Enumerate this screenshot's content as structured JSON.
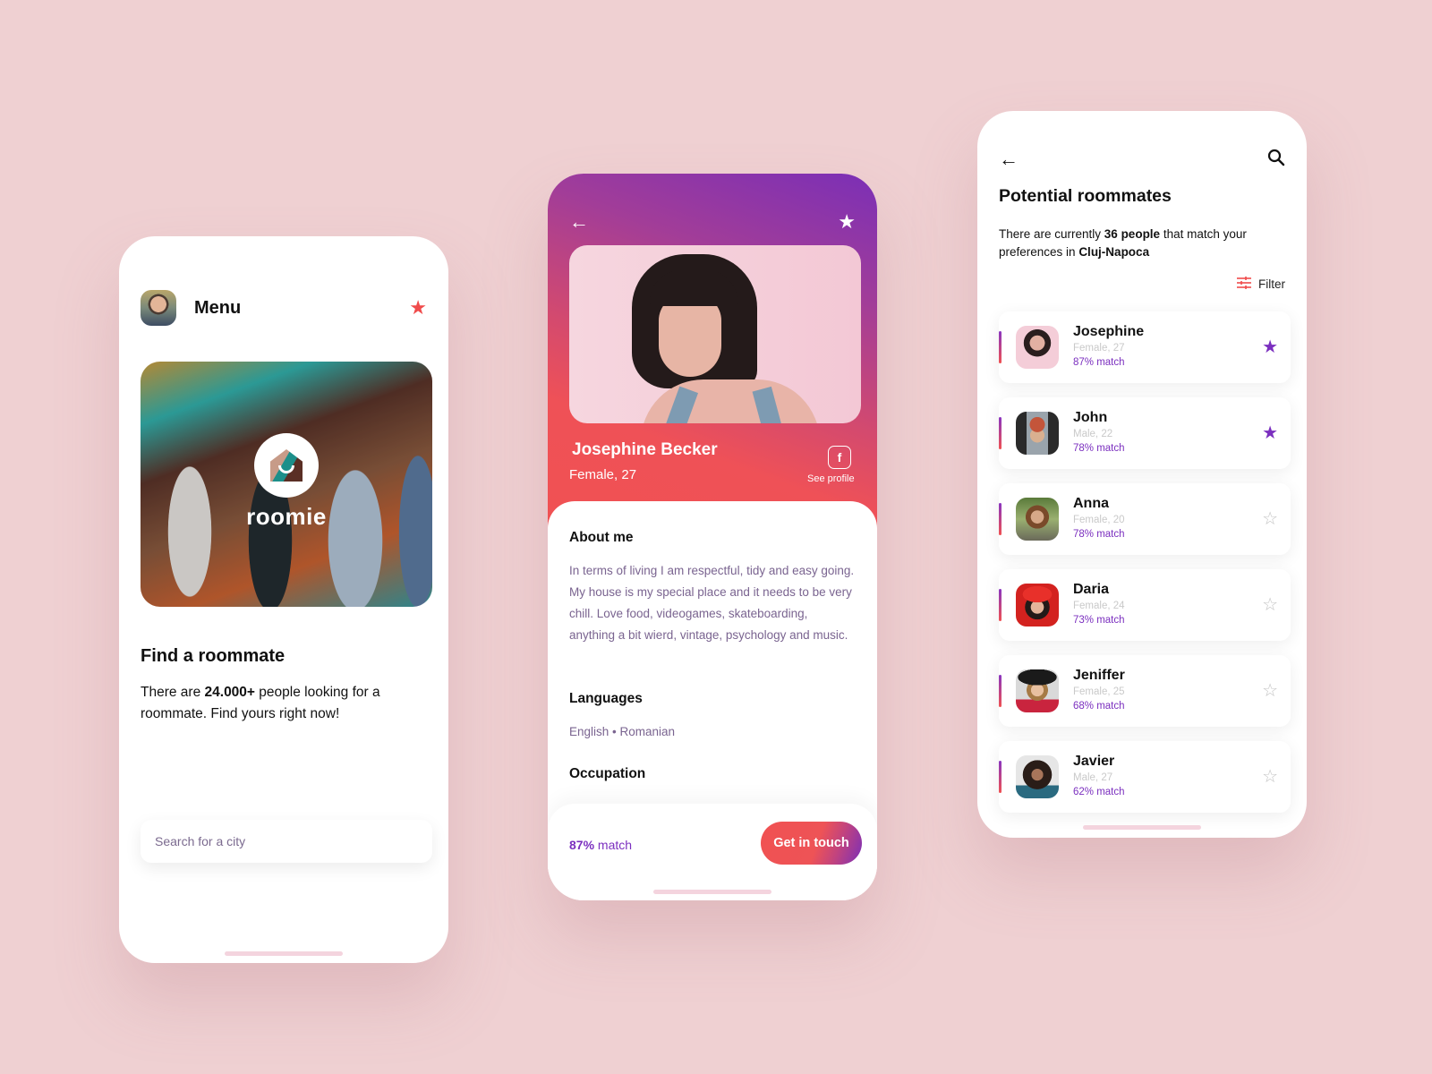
{
  "colors": {
    "background": "#efd0d2",
    "accent_red": "#f04b4b",
    "accent_purple": "#7b2fbf",
    "body_text_purple": "#7a6490"
  },
  "menu_screen": {
    "title": "Menu",
    "star_icon": "star-filled",
    "avatar_icon": "user-avatar",
    "hero_logo_text": "roomie",
    "heading": "Find a roommate",
    "desc_prefix": "There are ",
    "desc_bold": "24.000+",
    "desc_suffix": " people looking for a roommate. Find yours right now!",
    "search": {
      "placeholder": "Search for a city",
      "value": ""
    }
  },
  "profile_screen": {
    "back_icon": "arrow-left",
    "favorite_icon": "star-filled",
    "name": "Josephine Becker",
    "subtitle": "Female, 27",
    "facebook_icon": "f",
    "see_profile": "See profile",
    "about_title": "About me",
    "about_text": "In terms of living I am respectful, tidy and easy going. My house is my special place and it needs to be very chill. Love food, videogames, skateboarding, anything a bit wierd, vintage, psychology and music.",
    "languages_title": "Languages",
    "languages": "English • Romanian",
    "occupation_title": "Occupation",
    "match_percent": "87%",
    "match_label": " match",
    "cta_label": "Get in touch"
  },
  "roommates_screen": {
    "back_icon": "arrow-left",
    "search_icon": "search",
    "title": "Potential roommates",
    "desc_prefix": "There are currently ",
    "desc_count": "36 people",
    "desc_middle": " that match your preferences in ",
    "desc_city": "Cluj-Napoca",
    "filter_label": "Filter",
    "items": [
      {
        "name": "Josephine",
        "detail": "Female, 27",
        "match": "87% match",
        "favorite": true
      },
      {
        "name": "John",
        "detail": "Male, 22",
        "match": "78% match",
        "favorite": true
      },
      {
        "name": "Anna",
        "detail": "Female, 20",
        "match": "78% match",
        "favorite": false
      },
      {
        "name": "Daria",
        "detail": "Female, 24",
        "match": "73% match",
        "favorite": false
      },
      {
        "name": "Jeniffer",
        "detail": "Female, 25",
        "match": "68% match",
        "favorite": false
      },
      {
        "name": "Javier",
        "detail": "Male, 27",
        "match": "62% match",
        "favorite": false
      }
    ]
  }
}
